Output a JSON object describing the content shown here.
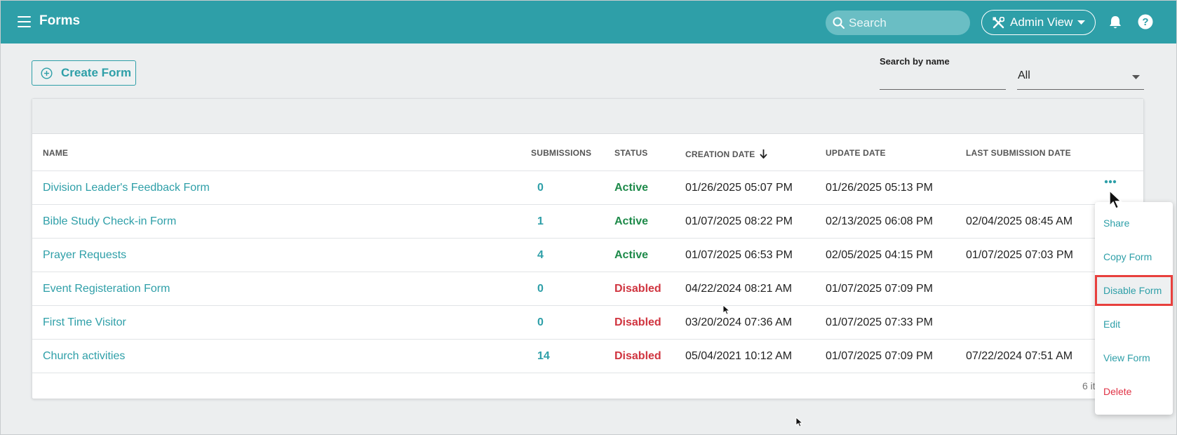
{
  "topbar": {
    "title": "Forms",
    "search_placeholder": "Search",
    "admin_view_label": "Admin View"
  },
  "controls": {
    "create_form_label": "Create Form",
    "search_by_name_label": "Search by name",
    "status_filter_value": "All"
  },
  "table": {
    "columns": {
      "name": "NAME",
      "submissions": "SUBMISSIONS",
      "status": "STATUS",
      "creation_date": "CREATION DATE",
      "update_date": "UPDATE DATE",
      "last_submission_date": "LAST SUBMISSION DATE"
    },
    "rows": [
      {
        "name": "Division Leader's Feedback Form",
        "submissions": "0",
        "status": "Active",
        "created": "01/26/2025 05:07 PM",
        "updated": "01/26/2025 05:13 PM",
        "last_submission": ""
      },
      {
        "name": "Bible Study Check-in Form",
        "submissions": "1",
        "status": "Active",
        "created": "01/07/2025 08:22 PM",
        "updated": "02/13/2025 06:08 PM",
        "last_submission": "02/04/2025 08:45 AM"
      },
      {
        "name": "Prayer Requests",
        "submissions": "4",
        "status": "Active",
        "created": "01/07/2025 06:53 PM",
        "updated": "02/05/2025 04:15 PM",
        "last_submission": "01/07/2025 07:03 PM"
      },
      {
        "name": "Event Registeration Form",
        "submissions": "0",
        "status": "Disabled",
        "created": "04/22/2024 08:21 AM",
        "updated": "01/07/2025 07:09 PM",
        "last_submission": ""
      },
      {
        "name": "First Time Visitor",
        "submissions": "0",
        "status": "Disabled",
        "created": "03/20/2024 07:36 AM",
        "updated": "01/07/2025 07:33 PM",
        "last_submission": ""
      },
      {
        "name": "Church activities",
        "submissions": "14",
        "status": "Disabled",
        "created": "05/04/2021 10:12 AM",
        "updated": "01/07/2025 07:09 PM",
        "last_submission": "07/22/2024 07:51 AM"
      }
    ],
    "footer_count": "6 it"
  },
  "context_menu": {
    "items": [
      {
        "label": "Share",
        "kind": "normal"
      },
      {
        "label": "Copy Form",
        "kind": "normal"
      },
      {
        "label": "Disable Form",
        "kind": "highlight"
      },
      {
        "label": "Edit",
        "kind": "normal"
      },
      {
        "label": "View Form",
        "kind": "normal"
      },
      {
        "label": "Delete",
        "kind": "danger"
      }
    ]
  },
  "colors": {
    "brand": "#2e9fa8",
    "active": "#1e8a4a",
    "disabled": "#d0343f",
    "highlight_outline": "#e8403d"
  },
  "icons": [
    "hamburger-icon",
    "search-icon",
    "tools-icon",
    "chevron-down-icon",
    "bell-icon",
    "help-icon",
    "plus-circle-icon",
    "sort-arrow-down-icon",
    "more-options-icon",
    "cursor-icon"
  ]
}
